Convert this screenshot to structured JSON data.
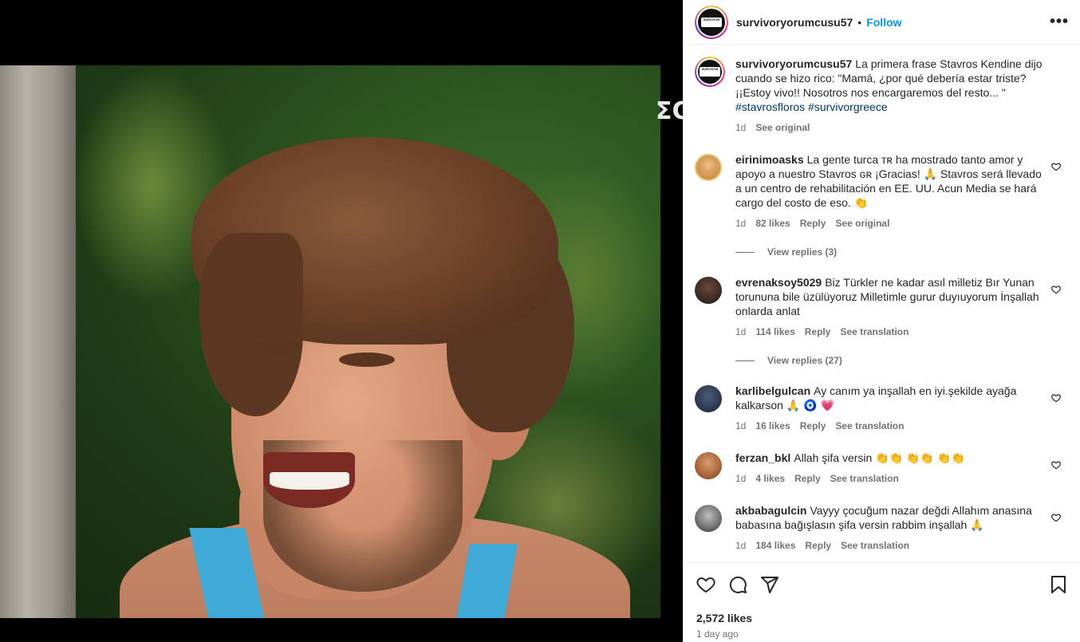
{
  "post": {
    "username": "survivoryorumcusu57",
    "follow_label": "Follow",
    "more_label": "•••",
    "tv_logo_text": "ΣC"
  },
  "caption": {
    "username": "survivoryorumcusu57",
    "text": "La primera frase Stavros Kendine dijo cuando se hizo rico: \"Mamá, ¿por qué debería estar triste? ¡¡Estoy vivo!! Nosotros nos encargaremos del resto... \"",
    "hashtags": "#stavrosfloros #survivorgreece",
    "time": "1d",
    "see_original": "See original"
  },
  "comments": [
    {
      "username": "eirinimoasks",
      "text": "La gente turca ᴛʀ ha mostrado tanto amor y apoyo a nuestro Stavros ɢʀ ¡Gracias! 🙏 Stavros será llevado a un centro de rehabilitación en EE. UU. Acun Media se hará cargo del costo de eso. 👏",
      "time": "1d",
      "likes": "82 likes",
      "reply": "Reply",
      "translate": "See original",
      "view_replies": "View replies (3)"
    },
    {
      "username": "evrenaksoy5029",
      "text": "Biz Türkler ne kadar asıl milletiz Bır Yunan torununa bile üzülüyoruz Milletimle gurur duyıuyorum İnşallah onlarda anlat",
      "time": "1d",
      "likes": "114 likes",
      "reply": "Reply",
      "translate": "See translation",
      "view_replies": "View replies (27)"
    },
    {
      "username": "karlibelgulcan",
      "text": "Ay canım ya inşallah en iyi.şekilde ayağa kalkarson 🙏 🧿 💗",
      "time": "1d",
      "likes": "16 likes",
      "reply": "Reply",
      "translate": "See translation"
    },
    {
      "username": "ferzan_bkl",
      "text": "Allah şifa versin 👏👏 👏👏 👏👏",
      "time": "1d",
      "likes": "4 likes",
      "reply": "Reply",
      "translate": "See translation"
    },
    {
      "username": "akbabagulcin",
      "text": "Vayyy çocuğum nazar değdi Allahım anasına babasına bağışlasın şifa versin rabbim inşallah 🙏",
      "time": "1d",
      "likes": "184 likes",
      "reply": "Reply",
      "translate": "See translation"
    }
  ],
  "footer": {
    "likes": "2,572 likes",
    "ago": "1 day ago"
  },
  "icons": {
    "like": "heart-icon",
    "comment": "comment-icon",
    "share": "share-icon",
    "save": "bookmark-icon",
    "more": "more-options-icon"
  },
  "colors": {
    "accent": "#0095f6",
    "text": "#262626",
    "secondary": "#737373",
    "hashtag": "#00376b"
  }
}
